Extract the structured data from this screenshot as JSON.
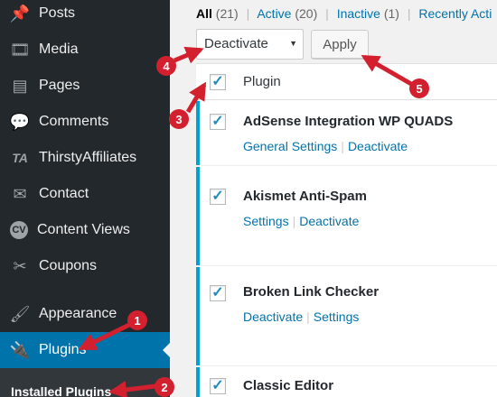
{
  "sidebar": {
    "items": [
      {
        "label": "Posts",
        "icon": "pin-icon",
        "glyph": "📌"
      },
      {
        "label": "Media",
        "icon": "media-icon",
        "glyph": "🎞"
      },
      {
        "label": "Pages",
        "icon": "pages-icon",
        "glyph": "▤"
      },
      {
        "label": "Comments",
        "icon": "comments-icon",
        "glyph": "💬"
      },
      {
        "label": "ThirstyAffiliates",
        "icon": "ta-icon",
        "glyph": "TA"
      },
      {
        "label": "Contact",
        "icon": "mail-icon",
        "glyph": "✉"
      },
      {
        "label": "Content Views",
        "icon": "cv-icon",
        "glyph": "CV"
      },
      {
        "label": "Coupons",
        "icon": "scissors-icon",
        "glyph": "✂"
      },
      {
        "label": "Appearance",
        "icon": "brush-icon",
        "glyph": "🖌"
      },
      {
        "label": "Plugins",
        "icon": "plug-icon",
        "glyph": "🔌"
      }
    ],
    "submenu_label": "Installed Plugins"
  },
  "filters": {
    "all": "All",
    "all_count": "(21)",
    "active": "Active",
    "active_count": "(20)",
    "inactive": "Inactive",
    "inactive_count": "(1)",
    "recent": "Recently Acti",
    "separator": "|"
  },
  "bulk": {
    "selected": "Deactivate",
    "apply": "Apply"
  },
  "table": {
    "header": "Plugin",
    "check_glyph": "✓",
    "rows": [
      {
        "title": "AdSense Integration WP QUADS",
        "actions": [
          "General Settings",
          "Deactivate"
        ]
      },
      {
        "title": "Akismet Anti-Spam",
        "actions": [
          "Settings",
          "Deactivate"
        ]
      },
      {
        "title": "Broken Link Checker",
        "actions": [
          "Deactivate",
          "Settings"
        ]
      },
      {
        "title": "Classic Editor",
        "actions": []
      }
    ]
  },
  "callouts": [
    "1",
    "2",
    "3",
    "4",
    "5"
  ],
  "colors": {
    "sidebar": "#23282d",
    "accent": "#0073aa",
    "callout": "#d2202f",
    "active_bar": "#00a0d2"
  }
}
